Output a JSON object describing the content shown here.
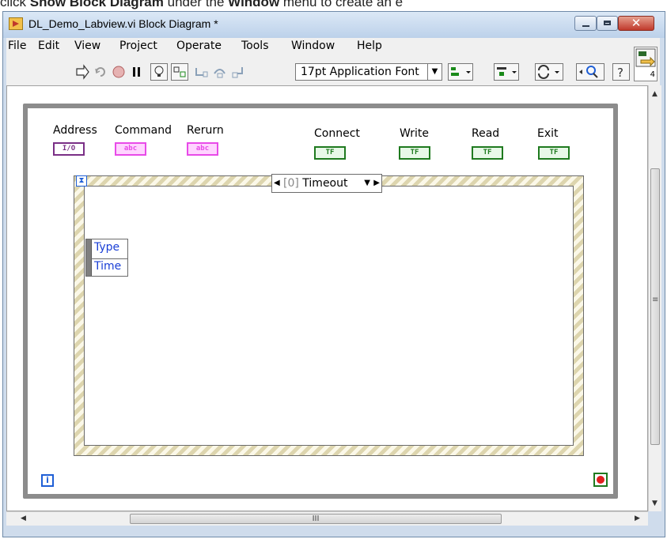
{
  "document_caption": {
    "before": "click ",
    "cmd1": "Show Block Diagram",
    "middle": " under the ",
    "cmd2": "Window",
    "after": " menu to create an e"
  },
  "window": {
    "title": "DL_Demo_Labview.vi Block Diagram *",
    "close_glyph": "✕"
  },
  "menu": {
    "items": [
      "File",
      "Edit",
      "View",
      "Project",
      "Operate",
      "Tools",
      "Window",
      "Help"
    ]
  },
  "toolbar": {
    "font_selector": "17pt Application Font",
    "context_help_number": "4"
  },
  "diagram": {
    "controls": [
      {
        "label": "Address",
        "terminal": "I/O"
      },
      {
        "label": "Command",
        "terminal": "abc"
      },
      {
        "label": "Rerurn",
        "terminal": "abc"
      },
      {
        "label": "Connect",
        "terminal": "TF"
      },
      {
        "label": "Write",
        "terminal": "TF"
      },
      {
        "label": "Read",
        "terminal": "TF"
      },
      {
        "label": "Exit",
        "terminal": "TF"
      }
    ],
    "event_case": {
      "index": "[0]",
      "name": "Timeout"
    },
    "event_data_node": {
      "rows": [
        "Type",
        "Time"
      ]
    },
    "iteration_terminal": "i",
    "timeout_glyph": "⧗"
  },
  "scrollbar": {
    "h_thumb_glyph": "III",
    "v_thumb_glyph": "≡"
  },
  "colors": {
    "loop_border": "#8c8c8c",
    "io_terminal": "#7a2f86",
    "string_terminal": "#e84ae8",
    "boolean_terminal": "#1f7a1f",
    "event_data_text": "#1a3fd6"
  }
}
